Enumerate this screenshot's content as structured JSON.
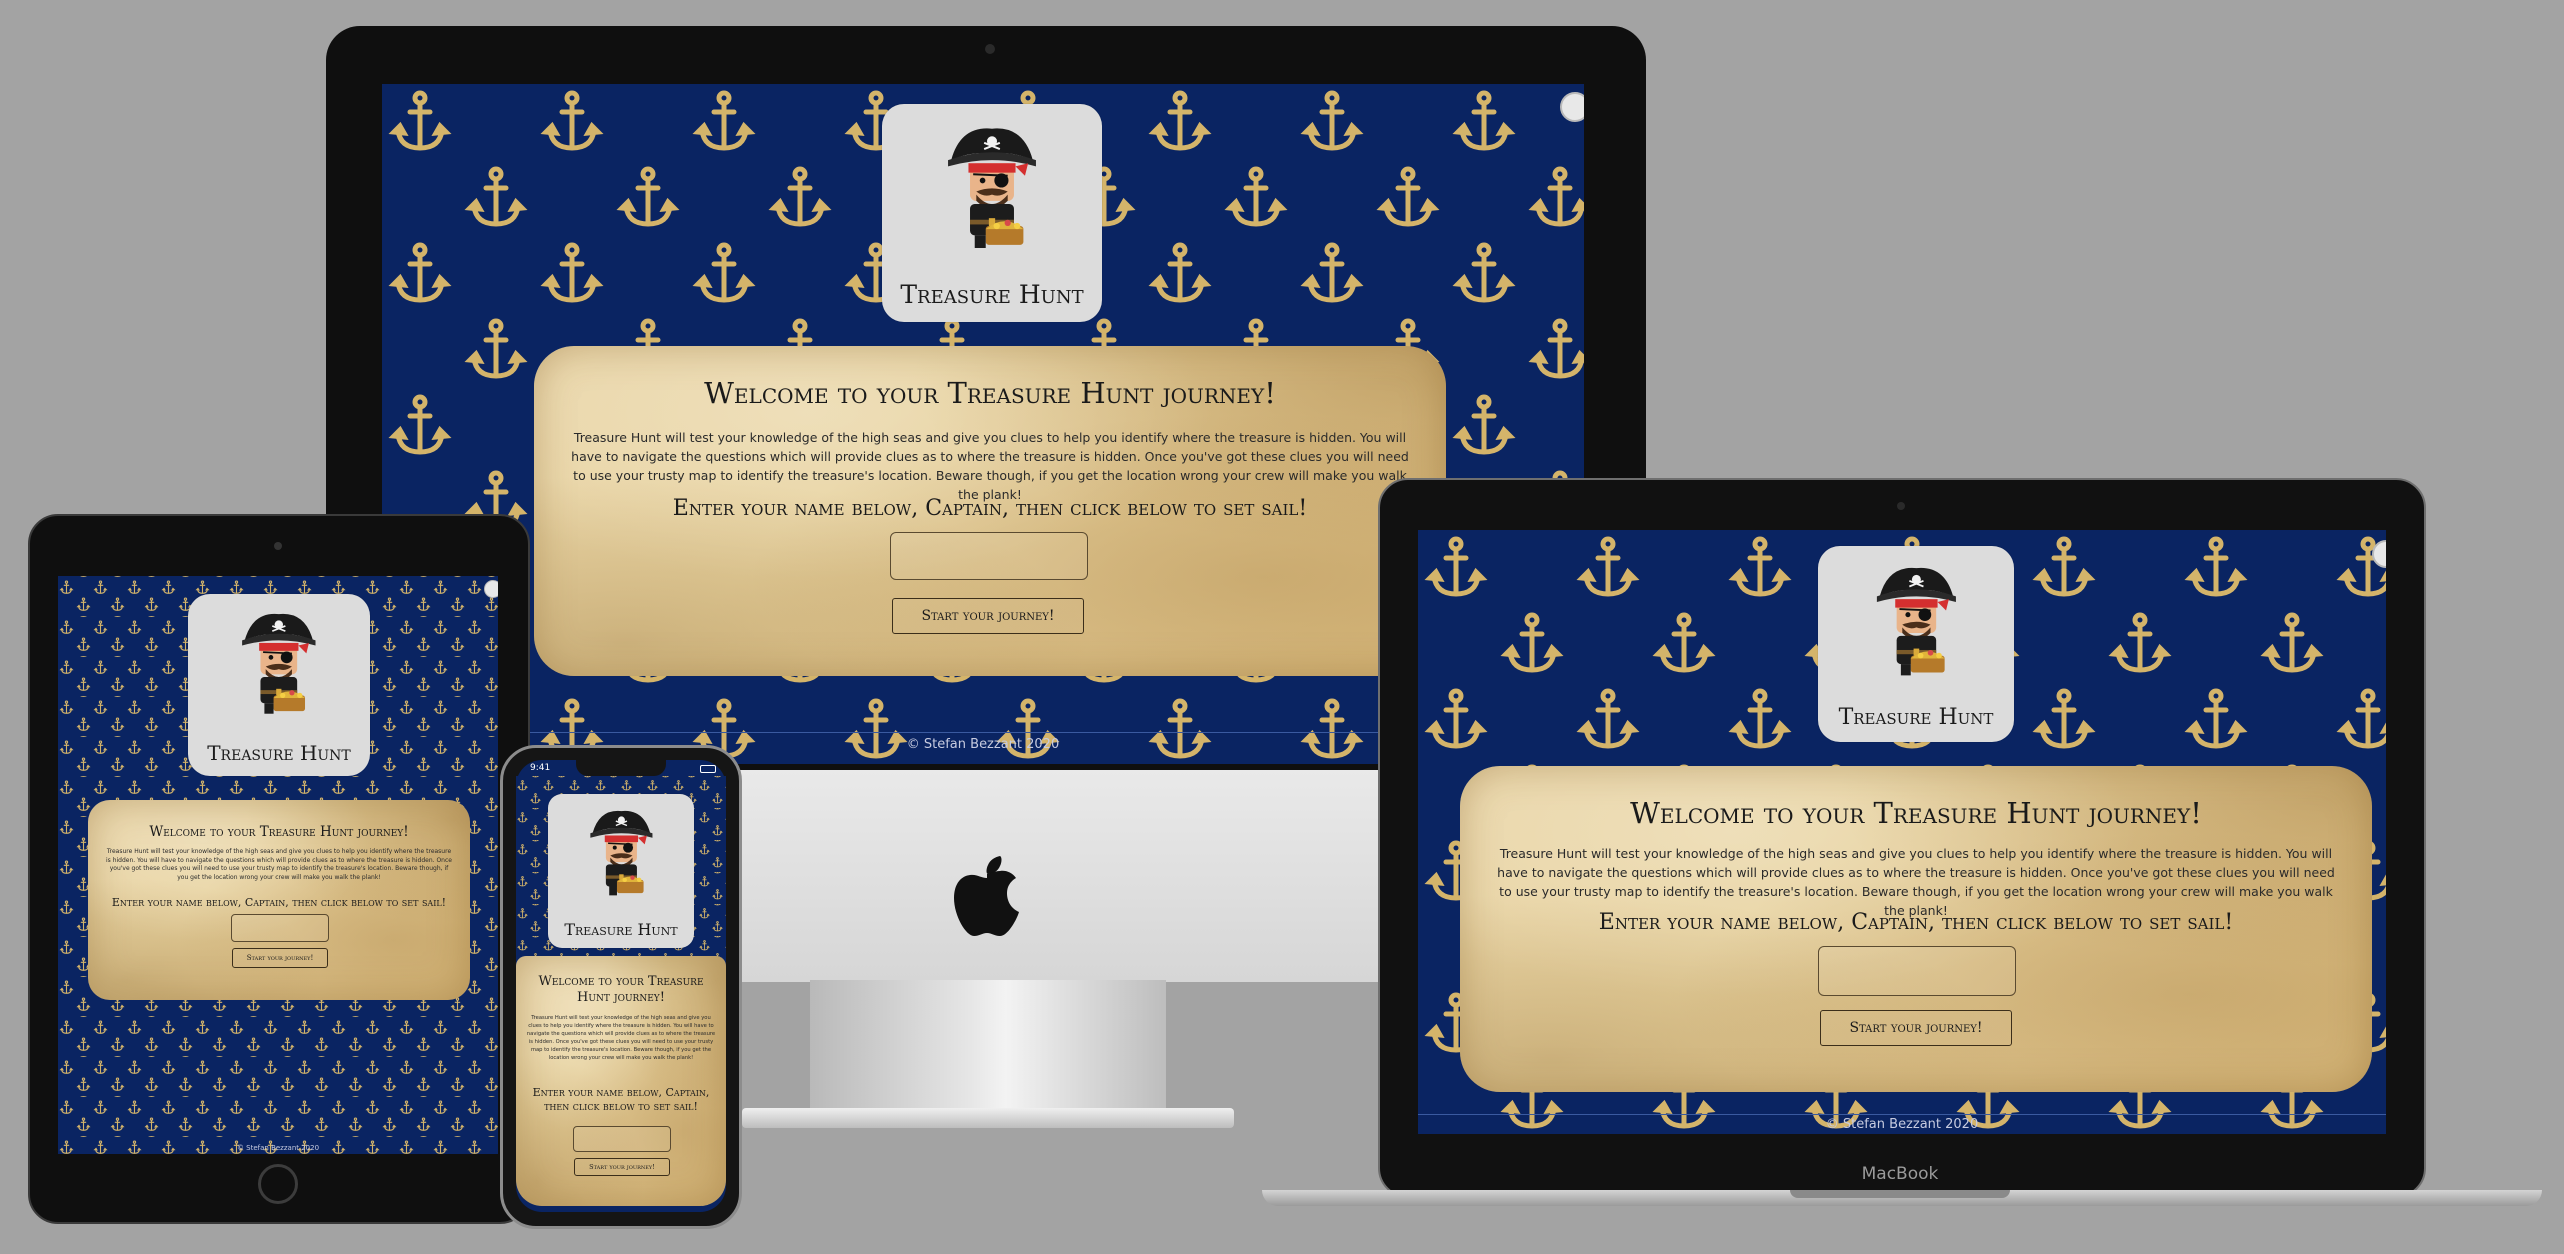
{
  "site": {
    "brand": "Treasure Hunt",
    "heading": "Welcome to your Treasure Hunt journey!",
    "intro": "Treasure Hunt will test your knowledge of the high seas and give you clues to help you identify where the treasure is hidden. You will have to navigate the questions which will provide clues as to where the treasure is hidden. Once you've got these clues you will need to use your trusty map to identify the treasure's location. Beware though, if you get the location wrong your crew will make you walk the plank!",
    "prompt": "Enter your name below, Captain, then click below to set sail!",
    "name_placeholder": "",
    "start_button": "Start your journey!",
    "footer": "© Stefan Bezzant 2020"
  },
  "devices": {
    "laptop_label": "MacBook",
    "phone_time": "9:41"
  },
  "colors": {
    "navy": "#0a2462",
    "gold": "#d4b46a",
    "parchment": "#e3cc98",
    "logo_bg": "#dcdcdc"
  },
  "icons": [
    "anchor-icon",
    "pirate-icon",
    "apple-logo-icon"
  ]
}
